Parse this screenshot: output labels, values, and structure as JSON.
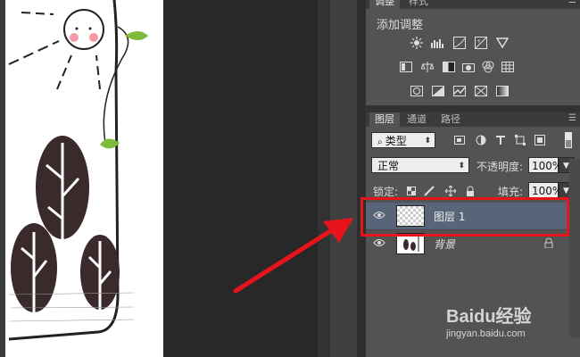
{
  "adjustments_panel": {
    "tabs": [
      "调整",
      "样式"
    ],
    "title": "添加调整",
    "icons_row1": [
      "brightness-contrast-icon",
      "levels-icon",
      "curves-icon",
      "exposure-icon",
      "vibrance-icon"
    ],
    "icons_row2": [
      "hue-saturation-icon",
      "color-balance-icon",
      "black-white-icon",
      "photo-filter-icon",
      "channel-mixer-icon",
      "color-lookup-icon"
    ],
    "icons_row3": [
      "invert-icon",
      "posterize-icon",
      "threshold-icon",
      "selective-color-icon",
      "gradient-map-icon"
    ]
  },
  "layers_panel": {
    "tabs": [
      "图层",
      "通道",
      "路径"
    ],
    "filter_kind": "类型",
    "blend_mode": "正常",
    "opacity_label": "不透明度:",
    "opacity_value": "100%",
    "lock_label": "锁定:",
    "fill_label": "填充:",
    "fill_value": "100%",
    "layers": [
      {
        "name": "图层 1",
        "selected": true,
        "locked": false
      },
      {
        "name": "背景",
        "selected": false,
        "locked": true
      }
    ]
  },
  "annotation": {
    "highlight_color": "#e8141b",
    "arrow_color": "#e8141b"
  },
  "watermark": {
    "brand": "Baidu经验",
    "url": "jingyan.baidu.com"
  }
}
